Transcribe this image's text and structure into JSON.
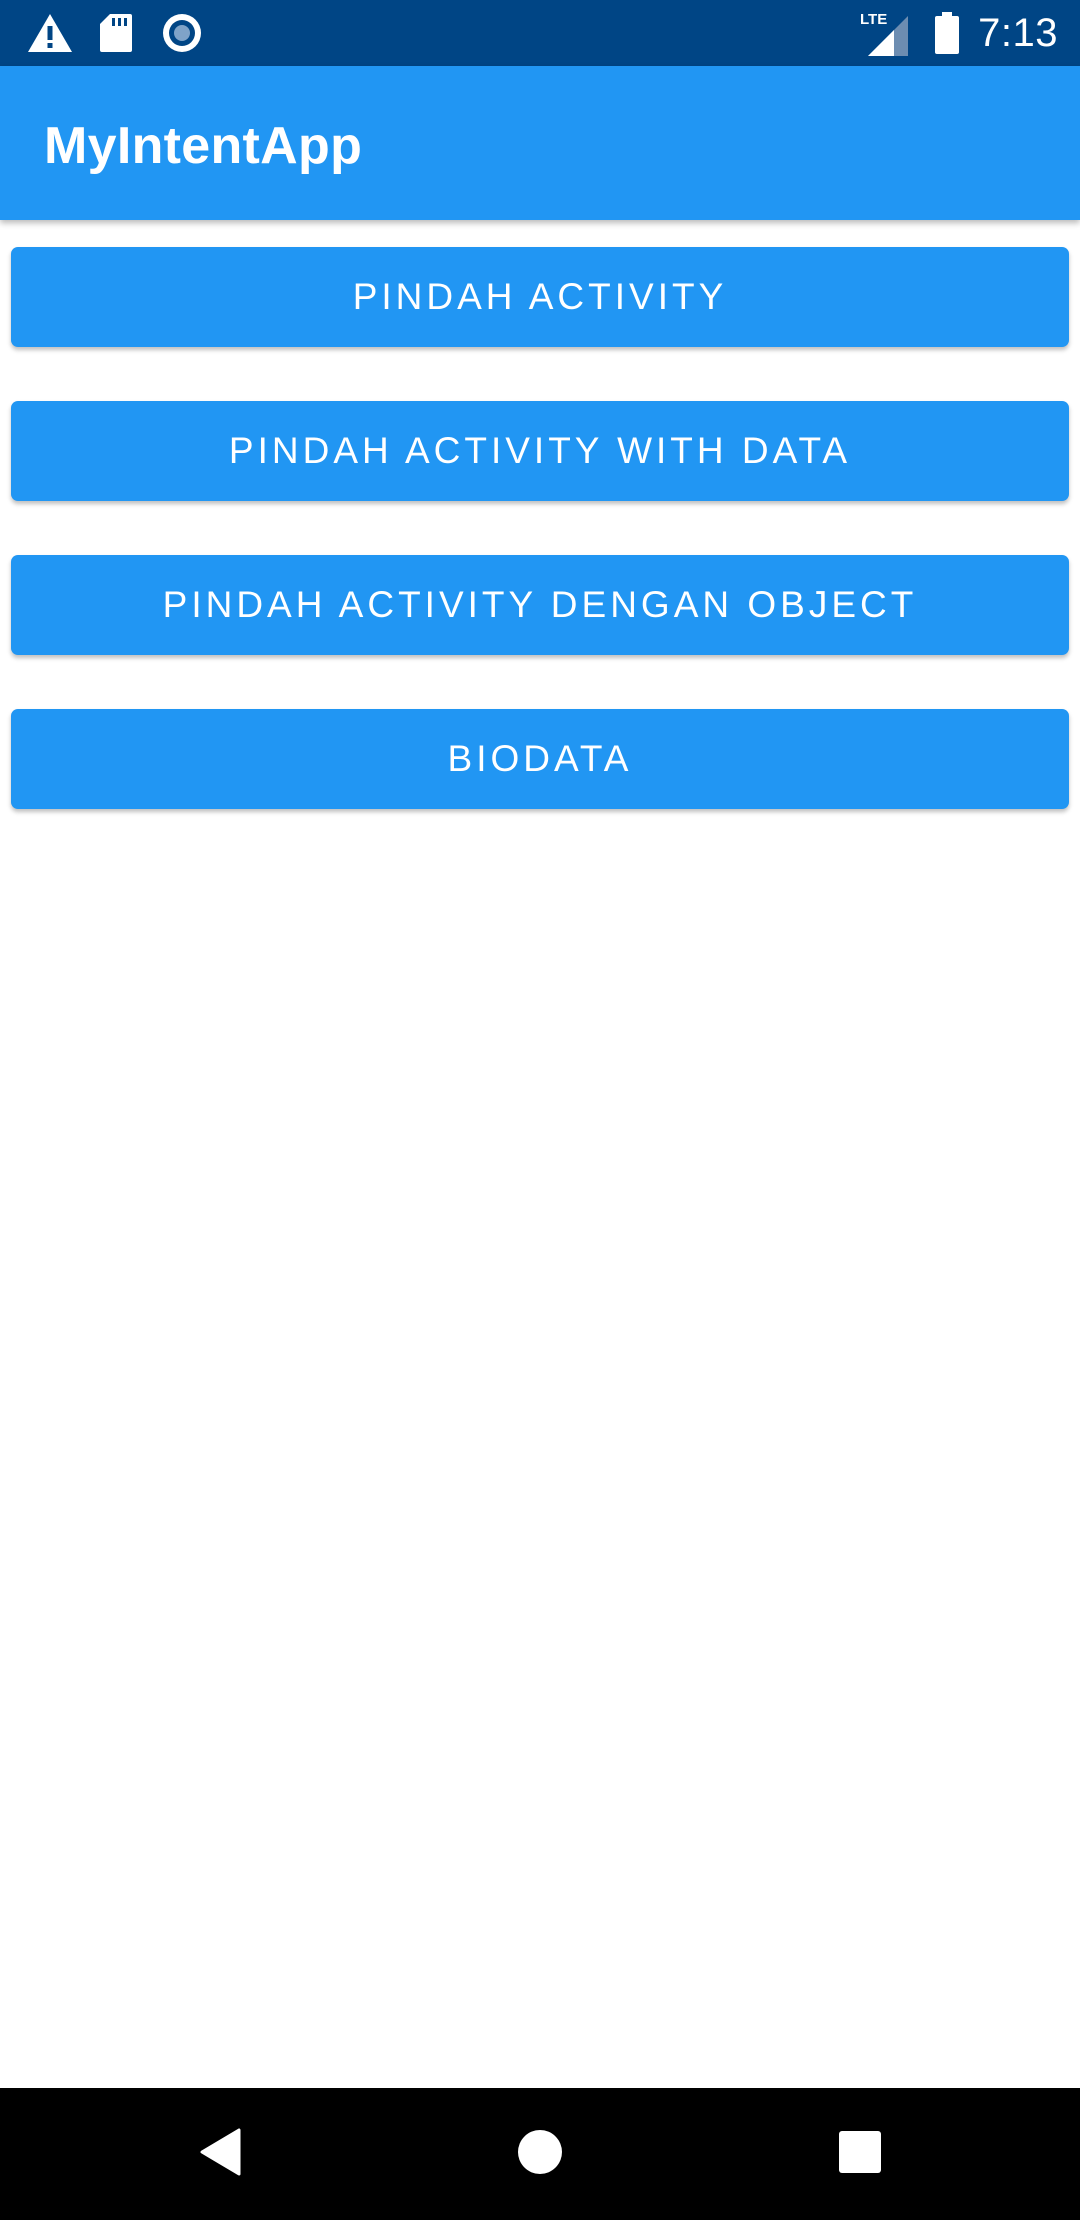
{
  "status_bar": {
    "time": "7:13",
    "network": "LTE",
    "icons": [
      "warning-icon",
      "sd-card-icon",
      "record-icon",
      "lte-signal-icon",
      "battery-icon"
    ]
  },
  "app_bar": {
    "title": "MyIntentApp"
  },
  "buttons": [
    {
      "label": "PINDAH ACTIVITY"
    },
    {
      "label": "PINDAH ACTIVITY WITH DATA"
    },
    {
      "label": "PINDAH ACTIVITY DENGAN OBJECT"
    },
    {
      "label": "BIODATA"
    }
  ],
  "nav_bar": {
    "icons": [
      "back-icon",
      "home-icon",
      "recent-apps-icon"
    ]
  },
  "colors": {
    "status_bar": "#004585",
    "primary": "#2196f3",
    "on_primary": "#ffffff",
    "background": "#ffffff",
    "nav_bar": "#000000"
  }
}
